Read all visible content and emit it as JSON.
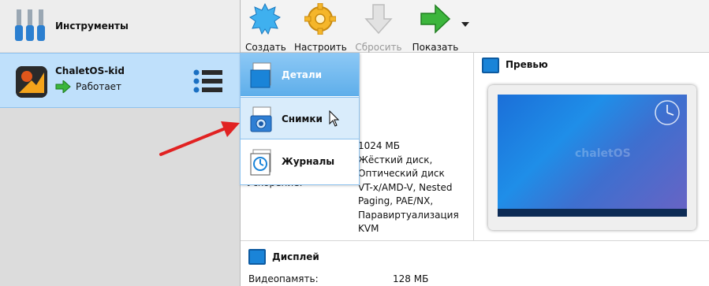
{
  "tools": {
    "title": "Инструменты"
  },
  "vm": {
    "name": "ChaletOS-kid",
    "state": "Работает"
  },
  "toolbar": {
    "create": "Создать",
    "settings": "Настроить",
    "discard": "Сбросить",
    "show": "Показать"
  },
  "popup": {
    "details": "Детали",
    "snapshots": "Снимки",
    "logs": "Журналы"
  },
  "details": {
    "acceleration_label": "Ускорение:",
    "lines": [
      "1024 МБ",
      "Жёсткий диск,",
      "Оптический диск",
      "VT-x/AMD-V, Nested",
      "Paging, PAE/NX,",
      "Паравиртуализация",
      "KVM"
    ]
  },
  "preview": {
    "title": "Превью",
    "watermark": "chaletOS"
  },
  "display": {
    "title": "Дисплей",
    "video_label": "Видеопамять:",
    "video_value": "128 МБ"
  },
  "colors": {
    "accent": "#1a84d8",
    "selection": "#bfe0fb",
    "arrow": "#e12222"
  }
}
